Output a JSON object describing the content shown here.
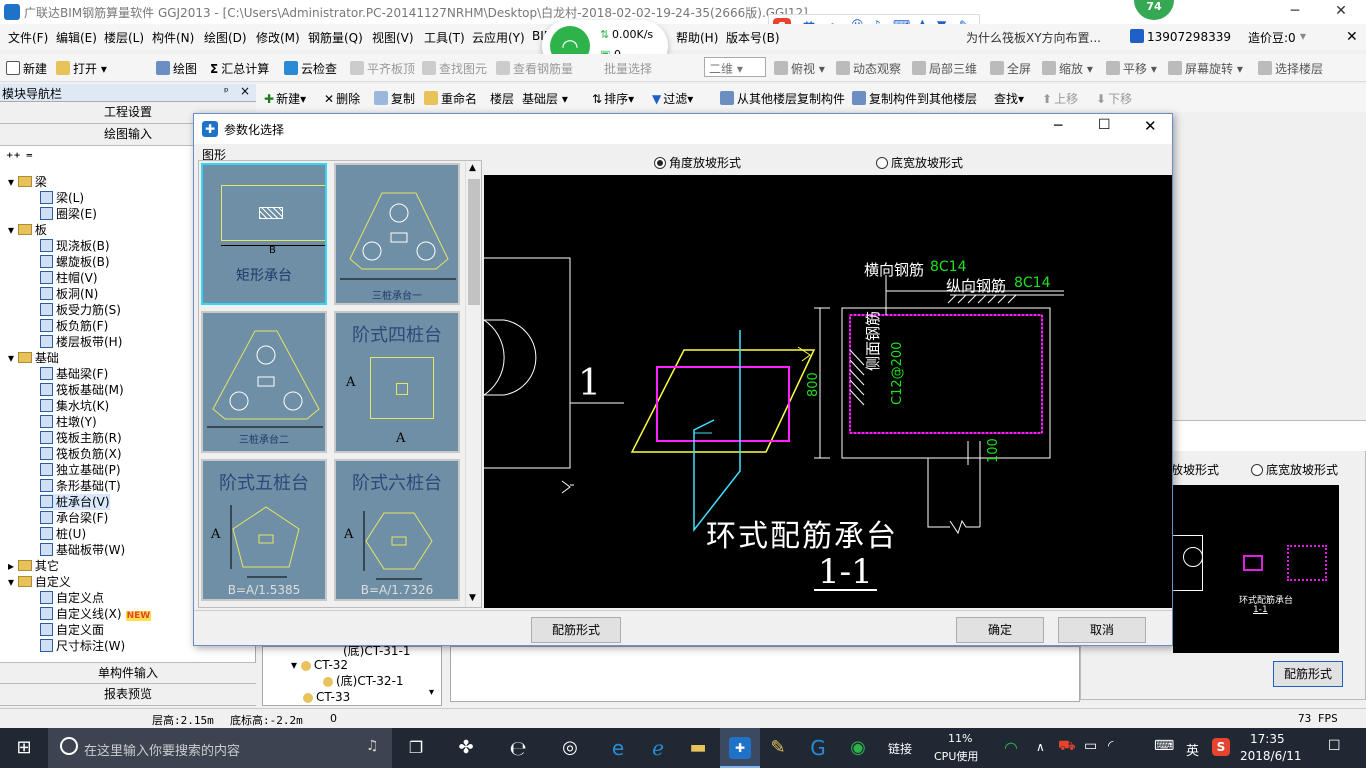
{
  "window": {
    "title": "广联达BIM钢筋算量软件 GGJ2013 - [C:\\Users\\Administrator.PC-20141127NRHM\\Desktop\\白龙村-2018-02-02-19-24-35(2666版).GGJ12]",
    "min": "─",
    "max": "❐",
    "close": "✕"
  },
  "menu": [
    "文件(F)",
    "编辑(E)",
    "楼层(L)",
    "构件(N)",
    "绘图(D)",
    "修改(M)",
    "钢筋量(Q)",
    "视图(V)",
    "工具(T)",
    "云应用(Y)",
    "BIM",
    "帮助(H)",
    "版本号(B)"
  ],
  "menu_right": {
    "ad": "为什么筏板XY方向布置...",
    "phone": "13907298339",
    "coins": "造价豆:0"
  },
  "ime_bar": {
    "label": "英"
  },
  "toolbar1": [
    {
      "label": "新建",
      "dis": false
    },
    {
      "label": "打开",
      "dis": false
    },
    {
      "label": "绘图",
      "dis": false
    },
    {
      "label": "汇总计算",
      "dis": false
    },
    {
      "label": "云检查",
      "dis": false
    },
    {
      "label": "平齐板顶",
      "dis": true
    },
    {
      "label": "查找图元",
      "dis": true
    },
    {
      "label": "查看钢筋量",
      "dis": true
    },
    {
      "label": "批量选择",
      "dis": true
    }
  ],
  "toolbar1_right": {
    "view_mode": "二维",
    "items": [
      "俯视",
      "动态观察",
      "局部三维",
      "全屏",
      "缩放",
      "平移",
      "屏幕旋转",
      "选择楼层"
    ]
  },
  "network_popup": {
    "speed": "0.00K/s",
    "count": "0"
  },
  "badge": {
    "value": "74"
  },
  "left_panel": {
    "title": "模块导航栏",
    "tabs": [
      "工程设置",
      "绘图输入"
    ],
    "bottom_tabs": [
      "单构件输入",
      "报表预览"
    ],
    "tree": [
      {
        "label": "梁",
        "lvl": 0,
        "folder": true
      },
      {
        "label": "梁(L)",
        "lvl": 1
      },
      {
        "label": "圈梁(E)",
        "lvl": 1
      },
      {
        "label": "板",
        "lvl": 0,
        "folder": true
      },
      {
        "label": "现浇板(B)",
        "lvl": 1
      },
      {
        "label": "螺旋板(B)",
        "lvl": 1
      },
      {
        "label": "柱帽(V)",
        "lvl": 1
      },
      {
        "label": "板洞(N)",
        "lvl": 1
      },
      {
        "label": "板受力筋(S)",
        "lvl": 1
      },
      {
        "label": "板负筋(F)",
        "lvl": 1
      },
      {
        "label": "楼层板带(H)",
        "lvl": 1
      },
      {
        "label": "基础",
        "lvl": 0,
        "folder": true
      },
      {
        "label": "基础梁(F)",
        "lvl": 1
      },
      {
        "label": "筏板基础(M)",
        "lvl": 1
      },
      {
        "label": "集水坑(K)",
        "lvl": 1
      },
      {
        "label": "柱墩(Y)",
        "lvl": 1
      },
      {
        "label": "筏板主筋(R)",
        "lvl": 1
      },
      {
        "label": "筏板负筋(X)",
        "lvl": 1
      },
      {
        "label": "独立基础(P)",
        "lvl": 1
      },
      {
        "label": "条形基础(T)",
        "lvl": 1
      },
      {
        "label": "桩承台(V)",
        "lvl": 1,
        "sel": true
      },
      {
        "label": "承台梁(F)",
        "lvl": 1
      },
      {
        "label": "桩(U)",
        "lvl": 1
      },
      {
        "label": "基础板带(W)",
        "lvl": 1
      },
      {
        "label": "其它",
        "lvl": 0,
        "folder": true,
        "collapsed": true
      },
      {
        "label": "自定义",
        "lvl": 0,
        "folder": true
      },
      {
        "label": "自定义点",
        "lvl": 1
      },
      {
        "label": "自定义线(X)",
        "lvl": 1,
        "new": "NEW"
      },
      {
        "label": "自定义面",
        "lvl": 1
      },
      {
        "label": "尺寸标注(W)",
        "lvl": 1
      }
    ]
  },
  "toolbar2": [
    "新建",
    "删除",
    "复制",
    "重命名",
    "楼层",
    "基础层",
    "排序",
    "过滤",
    "从其他楼层复制构件",
    "复制构件到其他楼层",
    "查找",
    "上移",
    "下移"
  ],
  "bg_list": [
    "(底)CT-31-1",
    "CT-32",
    "(底)CT-32-1",
    "CT-33"
  ],
  "dialog": {
    "title": "参数化选择",
    "group_label": "图形",
    "radio1": "角度放坡形式",
    "radio2": "底宽放坡形式",
    "thumbs": [
      {
        "name": "矩形承台",
        "sub": "B"
      },
      {
        "name": "三桩承台一"
      },
      {
        "name": "三桩承台二"
      },
      {
        "name": "阶式四桩台",
        "sub": "A"
      },
      {
        "name": "阶式五桩台",
        "sub": "B=A/1.5385"
      },
      {
        "name": "阶式六桩台",
        "sub": "B=A/1.7326"
      }
    ],
    "canvas": {
      "section_num": "1",
      "label_horiz": "横向钢筋",
      "horiz_val": "8C14",
      "label_vert": "纵向钢筋",
      "vert_val": "8C14",
      "side_label": "侧面钢筋",
      "side_val": "C12@200",
      "dim800": "800",
      "dim100": "100",
      "main_title": "环式配筋承台",
      "section": "1-1"
    },
    "btn_rebar": "配筋形式",
    "btn_ok": "确定",
    "btn_cancel": "取消"
  },
  "bg_dialog": {
    "radio1": "放坡形式",
    "radio2": "底宽放坡形式",
    "btn": "配筋形式"
  },
  "statusbar": {
    "floor_h": "层高:2.15m",
    "bottom_h": "底标高:-2.2m",
    "val": "0",
    "fps": "73 FPS"
  },
  "taskbar": {
    "search_placeholder": "在这里输入你要搜索的内容",
    "link": "链接",
    "cpu": "11%",
    "cpu_label": "CPU使用",
    "lang": "英",
    "time": "17:35",
    "date": "2018/6/11"
  }
}
